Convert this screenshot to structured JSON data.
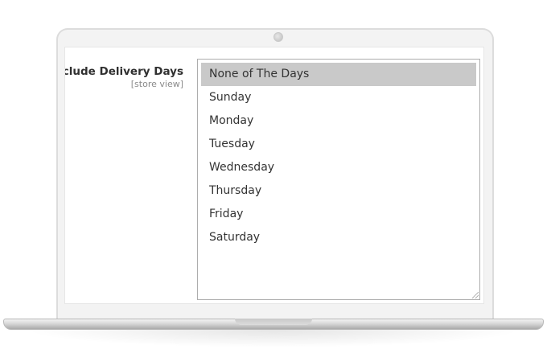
{
  "field": {
    "label": "Exclude Delivery Days",
    "scope": "[store view]"
  },
  "multiselect": {
    "options": [
      {
        "label": "None of The Days",
        "selected": true
      },
      {
        "label": "Sunday",
        "selected": false
      },
      {
        "label": "Monday",
        "selected": false
      },
      {
        "label": "Tuesday",
        "selected": false
      },
      {
        "label": "Wednesday",
        "selected": false
      },
      {
        "label": "Thursday",
        "selected": false
      },
      {
        "label": "Friday",
        "selected": false
      },
      {
        "label": "Saturday",
        "selected": false
      }
    ],
    "selected_color": "#c9c9c9"
  },
  "device": {
    "icon": "laptop-frame"
  }
}
